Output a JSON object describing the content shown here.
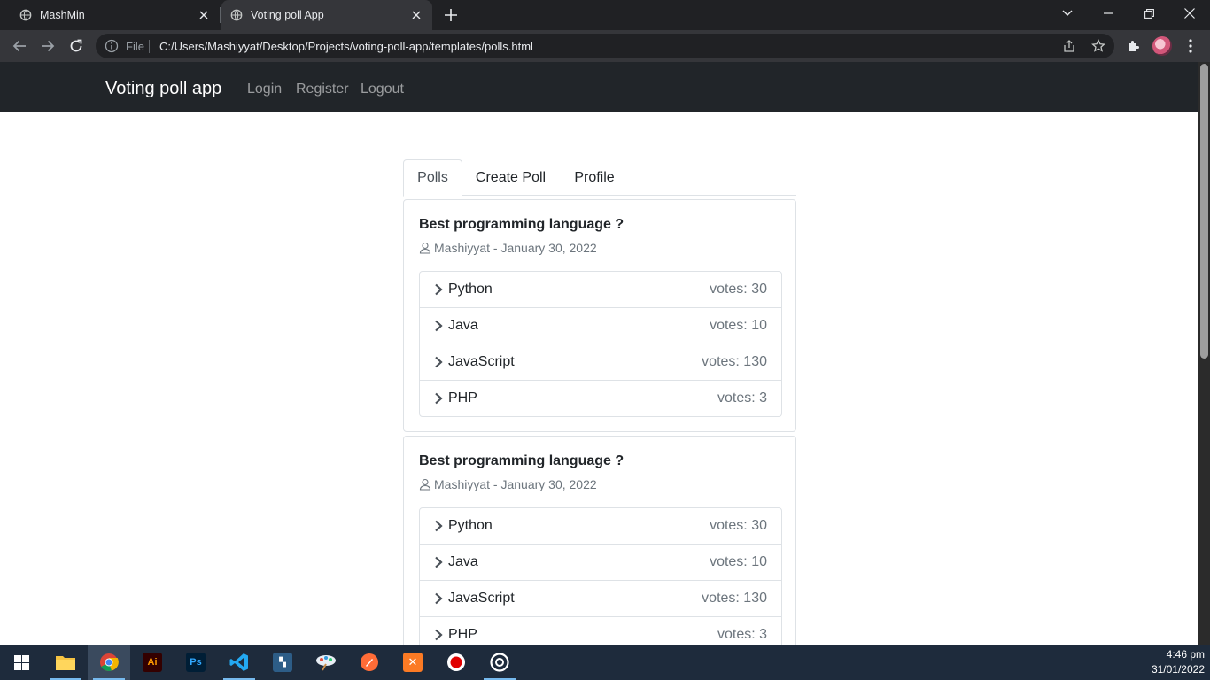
{
  "browser": {
    "tabs": [
      {
        "title": "MashMin"
      },
      {
        "title": "Voting poll App"
      }
    ],
    "url_prefix": "File",
    "url": "C:/Users/Mashiyyat/Desktop/Projects/voting-poll-app/templates/polls.html"
  },
  "app": {
    "brand": "Voting poll app",
    "nav": {
      "login": "Login",
      "register": "Register",
      "logout": "Logout"
    },
    "tabs": {
      "polls": "Polls",
      "create": "Create Poll",
      "profile": "Profile"
    }
  },
  "polls": [
    {
      "title": "Best programming language ?",
      "meta": "Mashiyyat - January 30, 2022",
      "choices": [
        {
          "name": "Python",
          "votes": "votes: 30"
        },
        {
          "name": "Java",
          "votes": "votes: 10"
        },
        {
          "name": "JavaScript",
          "votes": "votes: 130"
        },
        {
          "name": "PHP",
          "votes": "votes: 3"
        }
      ]
    },
    {
      "title": "Best programming language ?",
      "meta": "Mashiyyat - January 30, 2022",
      "choices": [
        {
          "name": "Python",
          "votes": "votes: 30"
        },
        {
          "name": "Java",
          "votes": "votes: 10"
        },
        {
          "name": "JavaScript",
          "votes": "votes: 130"
        },
        {
          "name": "PHP",
          "votes": "votes: 3"
        }
      ]
    }
  ],
  "taskbar": {
    "time": "4:46 pm",
    "date": "31/01/2022",
    "apps": [
      "start-icon",
      "file-explorer-icon",
      "chrome-icon",
      "illustrator-icon",
      "photoshop-icon",
      "vscode-icon",
      "mysql-workbench-icon",
      "paint-icon",
      "postman-icon",
      "xampp-icon",
      "recorder-icon",
      "obs-icon"
    ]
  },
  "colors": {
    "navbar": "#212529",
    "chrome_dark": "#202124",
    "chrome_toolbar": "#35363a",
    "taskbar": "#1e2b3c",
    "border": "#dee2e6",
    "muted": "#6c757d"
  }
}
